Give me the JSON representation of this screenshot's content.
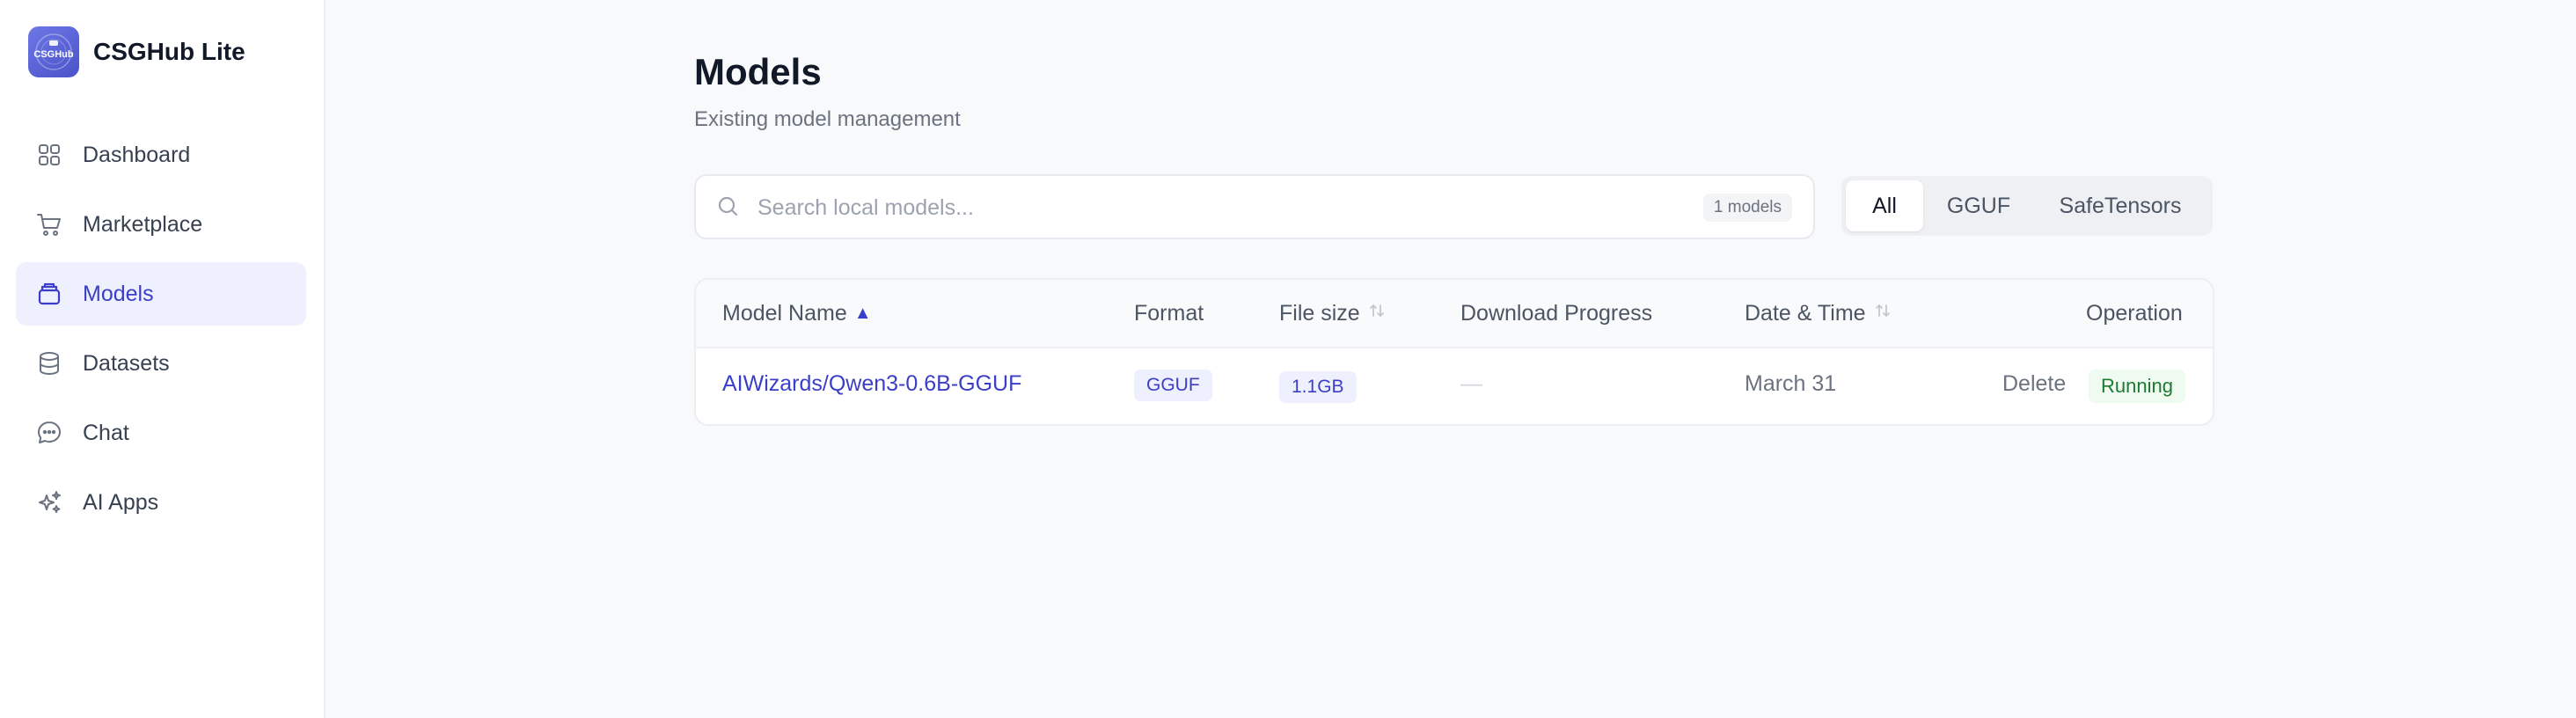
{
  "app": {
    "name": "CSGHub Lite",
    "logo_text": "CSGHub",
    "accent_color": "#3b3fc7"
  },
  "sidebar": {
    "items": [
      {
        "label": "Dashboard",
        "icon": "dashboard-icon",
        "active": false
      },
      {
        "label": "Marketplace",
        "icon": "cart-icon",
        "active": false
      },
      {
        "label": "Models",
        "icon": "models-icon",
        "active": true
      },
      {
        "label": "Datasets",
        "icon": "database-icon",
        "active": false
      },
      {
        "label": "Chat",
        "icon": "chat-icon",
        "active": false
      },
      {
        "label": "AI Apps",
        "icon": "sparkles-icon",
        "active": false
      }
    ]
  },
  "main": {
    "title": "Models",
    "subtitle": "Existing model management",
    "search": {
      "placeholder": "Search local models...",
      "value": "",
      "count": "1 models"
    },
    "filters": [
      {
        "label": "All",
        "active": true
      },
      {
        "label": "GGUF",
        "active": false
      },
      {
        "label": "SafeTensors",
        "active": false
      }
    ],
    "table": {
      "columns": {
        "name": "Model Name",
        "name_sort": "▲",
        "format": "Format",
        "size": "File size",
        "progress": "Download Progress",
        "date": "Date & Time",
        "operation": "Operation"
      },
      "rows": [
        {
          "name": "AIWizards/Qwen3-0.6B-GGUF",
          "format": "GGUF",
          "size": "1.1GB",
          "progress": "—",
          "date": "March 31",
          "action": "Delete",
          "status": "Running"
        }
      ]
    }
  }
}
